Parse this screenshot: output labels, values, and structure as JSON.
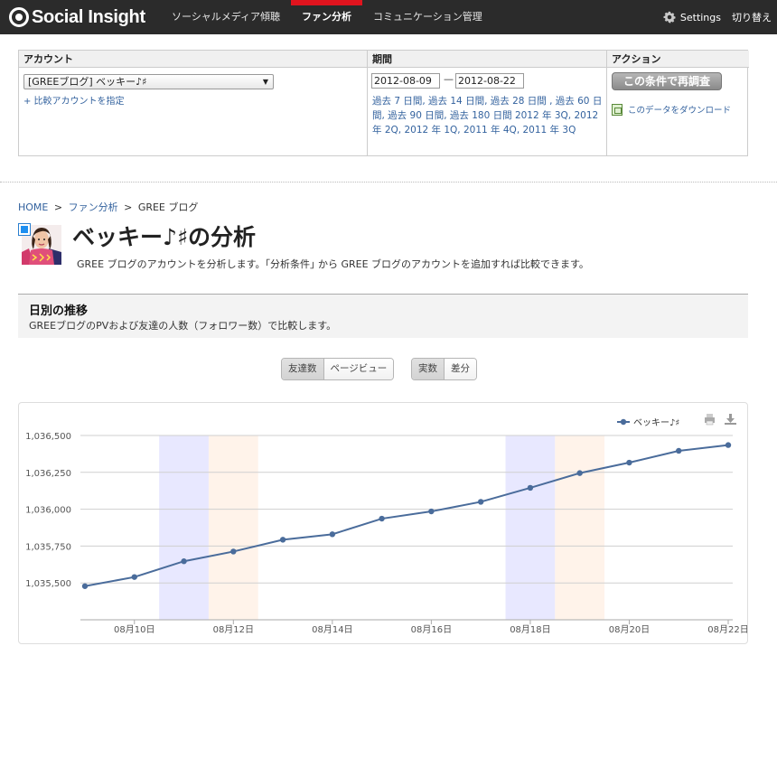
{
  "header": {
    "logo_text": "Social Insight",
    "nav": [
      {
        "label": "ソーシャルメディア傾聴",
        "active": false
      },
      {
        "label": "ファン分析",
        "active": true
      },
      {
        "label": "コミュニケーション管理",
        "active": false
      }
    ],
    "settings_label": "Settings",
    "switch_label": "切り替え"
  },
  "conditions": {
    "account_header": "アカウント",
    "period_header": "期間",
    "action_header": "アクション",
    "account_selected": "[GREEブログ] ベッキー♪♯",
    "compare_link": "+ 比較アカウントを指定",
    "date_from": "2012-08-09",
    "date_to": "2012-08-22",
    "date_dash": "—",
    "period_links": "過去 7 日間, 過去 14 日間, 過去 28 日間 , 過去 60 日間, 過去 90 日間, 過去 180 日間 2012 年 3Q, 2012 年 2Q, 2012 年 1Q, 2011 年 4Q, 2011 年 3Q",
    "rerun_button": "この条件で再調査",
    "download_link": "このデータをダウンロード"
  },
  "breadcrumb": {
    "home": "HOME",
    "sep": ">",
    "fan": "ファン分析",
    "current": "GREE ブログ"
  },
  "page": {
    "title": "ベッキー♪♯の分析",
    "description": "GREE ブログのアカウントを分析します。｢分析条件｣ から GREE ブログのアカウントを追加すれば比較できます。"
  },
  "section": {
    "title": "日別の推移",
    "description": "GREEブログのPVおよび友達の人数（フォロワー数）で比較します。"
  },
  "toggles": {
    "metric": [
      {
        "label": "友達数",
        "selected": true
      },
      {
        "label": "ページビュー",
        "selected": false
      }
    ],
    "mode": [
      {
        "label": "実数",
        "selected": true
      },
      {
        "label": "差分",
        "selected": false
      }
    ]
  },
  "chart_data": {
    "type": "line",
    "x": [
      "08月09日",
      "08月10日",
      "08月11日",
      "08月12日",
      "08月13日",
      "08月14日",
      "08月15日",
      "08月16日",
      "08月17日",
      "08月18日",
      "08月19日",
      "08月20日",
      "08月21日",
      "08月22日"
    ],
    "x_tick_labels": [
      "08月10日",
      "08月12日",
      "08月14日",
      "08月16日",
      "08月18日",
      "08月20日",
      "08月22日"
    ],
    "series": [
      {
        "name": "ベッキー♪♯",
        "color": "#4a6c9b",
        "values": [
          1035478,
          1035540,
          1035647,
          1035713,
          1035793,
          1035830,
          1035936,
          1035985,
          1036050,
          1036145,
          1036245,
          1036316,
          1036396,
          1036435
        ]
      }
    ],
    "y_ticks": [
      "1,035,500",
      "1,035,750",
      "1,036,000",
      "1,036,250",
      "1,036,500"
    ],
    "ylim": [
      1035250,
      1036500
    ],
    "weekend_bands": [
      {
        "from": "08月11日",
        "to": "08月11日",
        "kind": "saturday",
        "color": "#e8e8ff"
      },
      {
        "from": "08月12日",
        "to": "08月12日",
        "kind": "sunday",
        "color": "#fff3ea"
      },
      {
        "from": "08月18日",
        "to": "08月18日",
        "kind": "saturday",
        "color": "#e8e8ff"
      },
      {
        "from": "08月19日",
        "to": "08月19日",
        "kind": "sunday",
        "color": "#fff3ea"
      }
    ],
    "legend_position": "top-right",
    "grid": true
  }
}
